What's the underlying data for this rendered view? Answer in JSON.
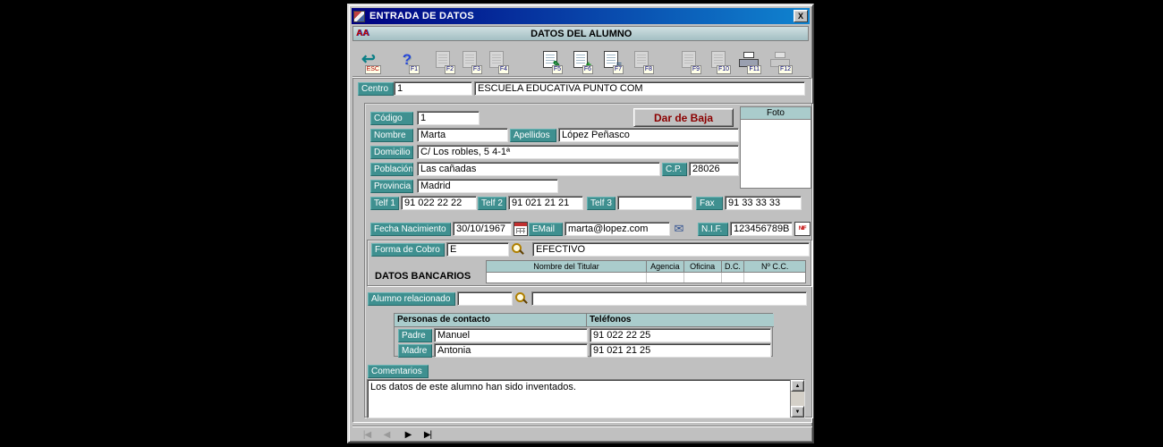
{
  "window": {
    "title": "ENTRADA DE DATOS",
    "close_label": "X"
  },
  "header": {
    "icon_text": "AA",
    "title": "DATOS DEL ALUMNO"
  },
  "toolbar": {
    "buttons": [
      {
        "name": "exit",
        "key": "ESC",
        "glyph": "↩",
        "enabled": true
      },
      {
        "name": "help",
        "key": "F1",
        "glyph": "?",
        "enabled": true
      },
      {
        "name": "f2",
        "key": "F2",
        "glyph": "",
        "enabled": false
      },
      {
        "name": "f3",
        "key": "F3",
        "glyph": "",
        "enabled": false
      },
      {
        "name": "f4",
        "key": "F4",
        "glyph": "",
        "enabled": false
      },
      {
        "name": "edit",
        "key": "F5",
        "glyph": "✎",
        "enabled": true
      },
      {
        "name": "new",
        "key": "F6",
        "glyph": "+",
        "enabled": true
      },
      {
        "name": "list",
        "key": "F7",
        "glyph": "≡",
        "enabled": true
      },
      {
        "name": "f8",
        "key": "F8",
        "glyph": "",
        "enabled": false
      },
      {
        "name": "f9",
        "key": "F9",
        "glyph": "",
        "enabled": false
      },
      {
        "name": "f10",
        "key": "F10",
        "glyph": "",
        "enabled": false
      },
      {
        "name": "print",
        "key": "F11",
        "glyph": "",
        "enabled": true
      },
      {
        "name": "f12",
        "key": "F12",
        "glyph": "",
        "enabled": false
      }
    ]
  },
  "centro": {
    "label": "Centro",
    "code": "1",
    "name": "ESCUELA EDUCATIVA PUNTO COM"
  },
  "student": {
    "codigo_label": "Código",
    "codigo": "1",
    "baja_button": "Dar de Baja",
    "foto_label": "Foto",
    "nombre_label": "Nombre",
    "nombre": "Marta",
    "apellidos_label": "Apellidos",
    "apellidos": "López Peñasco",
    "domicilio_label": "Domicilio",
    "domicilio": "C/ Los robles, 5 4-1ª",
    "poblacion_label": "Población",
    "poblacion": "Las cañadas",
    "cp_label": "C.P.",
    "cp": "28026",
    "provincia_label": "Provincia",
    "provincia": "Madrid",
    "telf1_label": "Telf 1",
    "telf1": "91 022 22 22",
    "telf2_label": "Telf 2",
    "telf2": "91 021 21 21",
    "telf3_label": "Telf 3",
    "telf3": "",
    "fax_label": "Fax",
    "fax": "91 33 33 33",
    "fecha_label": "Fecha Nacimiento",
    "fecha": "30/10/1967",
    "email_label": "EMail",
    "email": "marta@lopez.com",
    "nif_label": "N.I.F.",
    "nif": "123456789B"
  },
  "cobro": {
    "label": "Forma de Cobro",
    "code": "E",
    "descripcion": "EFECTIVO",
    "bancarios_label": "DATOS BANCARIOS",
    "bank_headers": [
      "Nombre del Titular",
      "Agencia",
      "Oficina",
      "D.C.",
      "Nº C.C."
    ],
    "bank_row": {
      "titular": "",
      "agencia": "",
      "oficina": "",
      "dc": "",
      "ncc": ""
    }
  },
  "relacionado": {
    "label": "Alumno relacionado",
    "code": "",
    "nombre": ""
  },
  "contactos": {
    "header_personas": "Personas de contacto",
    "header_telefonos": "Teléfonos",
    "rows": [
      {
        "rel": "Padre",
        "nombre": "Manuel",
        "telefono": "91 022 22 25"
      },
      {
        "rel": "Madre",
        "nombre": "Antonia",
        "telefono": "91 021 21 25"
      }
    ]
  },
  "comentarios": {
    "label": "Comentarios",
    "text": "Los datos de este alumno han sido inventados."
  },
  "nav": {
    "buttons": [
      {
        "name": "first",
        "glyph": "|◀",
        "enabled": false
      },
      {
        "name": "previous",
        "glyph": "◀",
        "enabled": false
      },
      {
        "name": "next",
        "glyph": "▶",
        "enabled": true
      },
      {
        "name": "last",
        "glyph": "▶|",
        "enabled": true
      }
    ]
  },
  "icons": {
    "email_glyph": "✉",
    "nif_text": "NIF",
    "scroll_up": "▲",
    "scroll_down": "▼"
  },
  "colors": {
    "label_teal": "#3f9090",
    "table_header": "#aacccc",
    "titlebar_start": "#000080",
    "titlebar_end": "#1084d0",
    "baja_red": "#8b0000",
    "window_gray": "#c0c0c0"
  }
}
